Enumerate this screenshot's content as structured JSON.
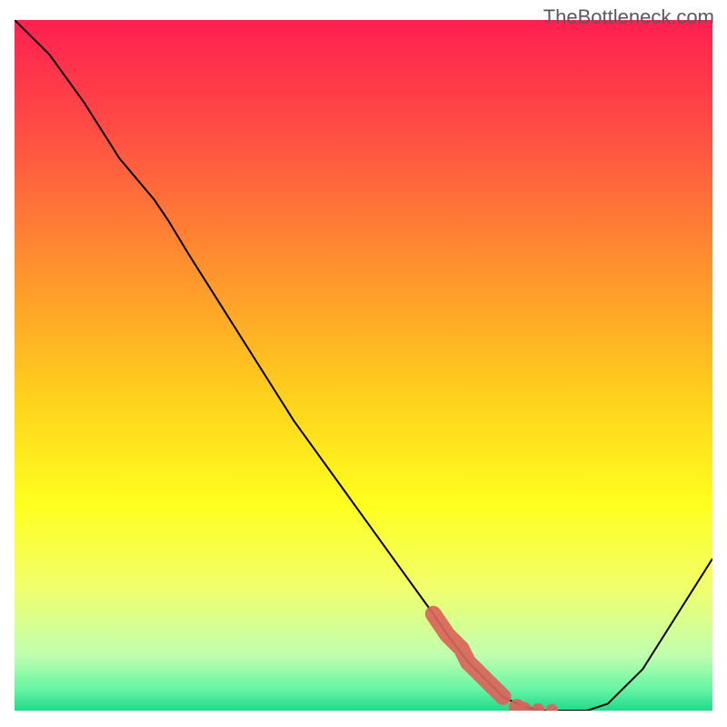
{
  "watermark": "TheBottleneck.com",
  "chart_data": {
    "type": "line",
    "title": "",
    "xlabel": "",
    "ylabel": "",
    "xlim": [
      0,
      100
    ],
    "ylim": [
      0,
      100
    ],
    "series": [
      {
        "name": "bottleneck-curve",
        "color": "#000000",
        "x": [
          0,
          5,
          10,
          15,
          20,
          22,
          25,
          30,
          35,
          40,
          45,
          50,
          55,
          60,
          62,
          65,
          70,
          72,
          75,
          78,
          80,
          82,
          85,
          90,
          95,
          100
        ],
        "y": [
          100,
          95,
          88,
          80,
          74,
          71,
          66,
          58,
          50,
          42,
          35,
          28,
          21,
          14,
          11,
          7,
          2,
          1,
          0,
          0,
          0,
          0,
          1,
          6,
          14,
          22
        ]
      },
      {
        "name": "highlighted-segment",
        "color": "#d9645b",
        "type": "scatter",
        "x": [
          60,
          61,
          62,
          63,
          64,
          65,
          66,
          67,
          68,
          69,
          70,
          72,
          73,
          75,
          77
        ],
        "y": [
          14,
          12.5,
          11,
          10,
          9,
          7,
          6,
          5,
          4,
          3,
          2,
          0.5,
          0.2,
          0.1,
          0.1
        ]
      }
    ],
    "gradient": {
      "orientation": "vertical",
      "stops": [
        {
          "pos": 0.0,
          "color": "#ff2050"
        },
        {
          "pos": 0.15,
          "color": "#ff4a45"
        },
        {
          "pos": 0.35,
          "color": "#ff8f2f"
        },
        {
          "pos": 0.55,
          "color": "#ffd21c"
        },
        {
          "pos": 0.7,
          "color": "#ffff1e"
        },
        {
          "pos": 0.82,
          "color": "#f2ff6a"
        },
        {
          "pos": 0.92,
          "color": "#c0ffb0"
        },
        {
          "pos": 0.97,
          "color": "#64f5a4"
        },
        {
          "pos": 1.0,
          "color": "#20d88a"
        }
      ]
    }
  }
}
